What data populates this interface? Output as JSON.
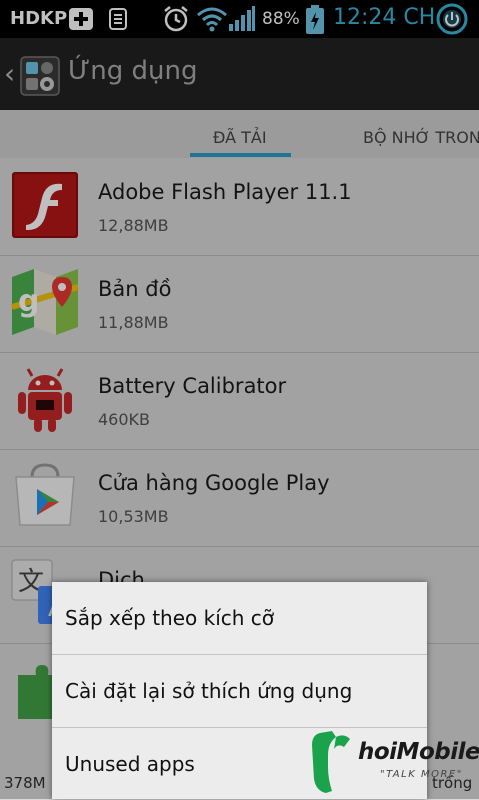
{
  "status_bar": {
    "carrier": "HDKP",
    "battery_percent": "88%",
    "time": "12:24 CH",
    "icons": [
      "plus-icon",
      "sim-icon",
      "alarm-icon",
      "wifi-icon",
      "signal-icon",
      "battery-icon",
      "power-icon"
    ]
  },
  "action_bar": {
    "title": "Ứng dụng"
  },
  "tabs": [
    {
      "label": "ĐÃ TẢI",
      "selected": true
    },
    {
      "label": "BỘ NHỚ TRON",
      "selected": false
    }
  ],
  "apps": [
    {
      "name": "Adobe Flash Player 11.1",
      "size": "12,88MB",
      "icon": "flash-icon"
    },
    {
      "name": "Bản đồ",
      "size": "11,88MB",
      "icon": "maps-icon"
    },
    {
      "name": "Battery Calibrator",
      "size": "460KB",
      "icon": "android-icon"
    },
    {
      "name": "Cửa hàng Google Play",
      "size": "10,53MB",
      "icon": "play-store-icon"
    },
    {
      "name": "Dịch",
      "size": "",
      "icon": "translate-icon"
    }
  ],
  "bottom_bar": {
    "used": "378M",
    "free": "trống"
  },
  "menu": {
    "options": [
      "Sắp xếp theo kích cỡ",
      "Cài đặt lại sở thích ứng dụng",
      "Unused apps"
    ]
  },
  "watermark": {
    "brand": "hoiMobile",
    "tagline": "\"TALK MORE\""
  },
  "colors": {
    "accent": "#2a9ec6",
    "clock": "#39b7d8",
    "statusbar": "#000000",
    "actionbar": "#222222"
  }
}
